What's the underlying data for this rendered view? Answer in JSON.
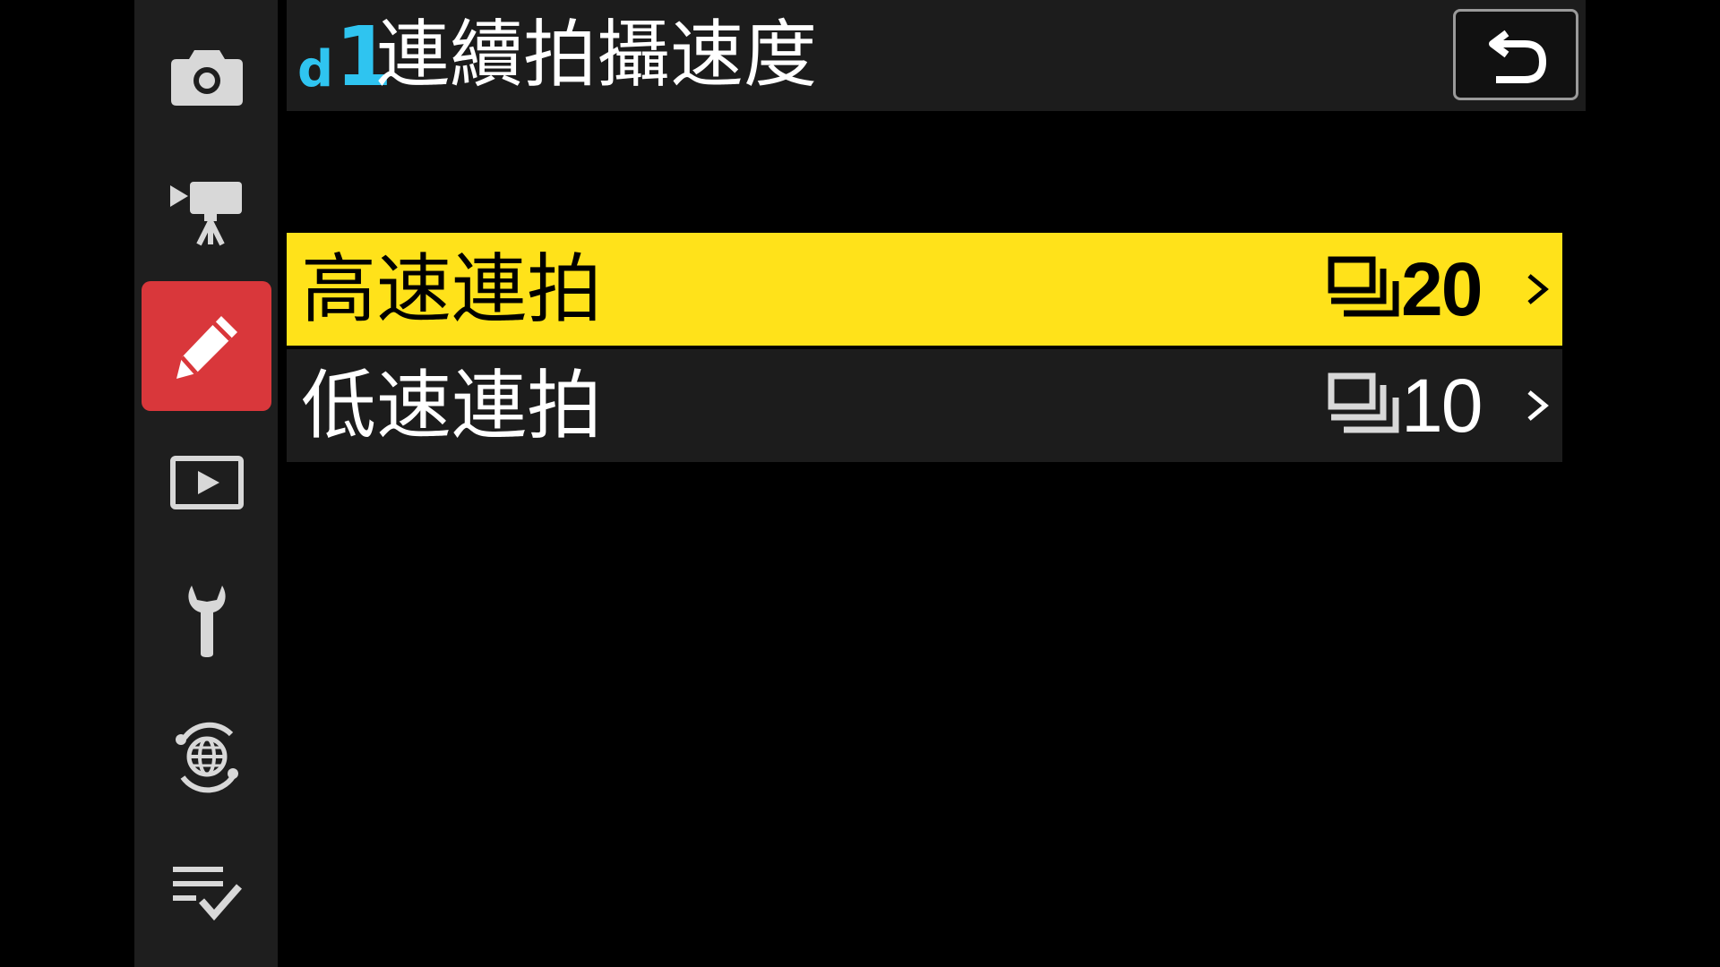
{
  "colors": {
    "background": "#000000",
    "sidebar": "#1e1e1e",
    "active_tab": "#d9373b",
    "highlight": "#ffe21a",
    "code_accent": "#2fc4f0"
  },
  "sidebar": {
    "items": [
      {
        "icon": "camera-icon",
        "active": false
      },
      {
        "icon": "movie-camera-icon",
        "active": false
      },
      {
        "icon": "pencil-icon",
        "active": true
      },
      {
        "icon": "playback-icon",
        "active": false
      },
      {
        "icon": "wrench-icon",
        "active": false
      },
      {
        "icon": "network-globe-icon",
        "active": false
      },
      {
        "icon": "my-menu-checklist-icon",
        "active": false
      }
    ]
  },
  "header": {
    "code_letter": "d",
    "code_number": "1",
    "title": "連續拍攝速度",
    "back_icon": "back-arrow-icon"
  },
  "menu": {
    "items": [
      {
        "label": "高速連拍",
        "icon": "burst-frames-icon",
        "value": "20",
        "selected": true
      },
      {
        "label": "低速連拍",
        "icon": "burst-frames-icon",
        "value": "10",
        "selected": false
      }
    ]
  }
}
